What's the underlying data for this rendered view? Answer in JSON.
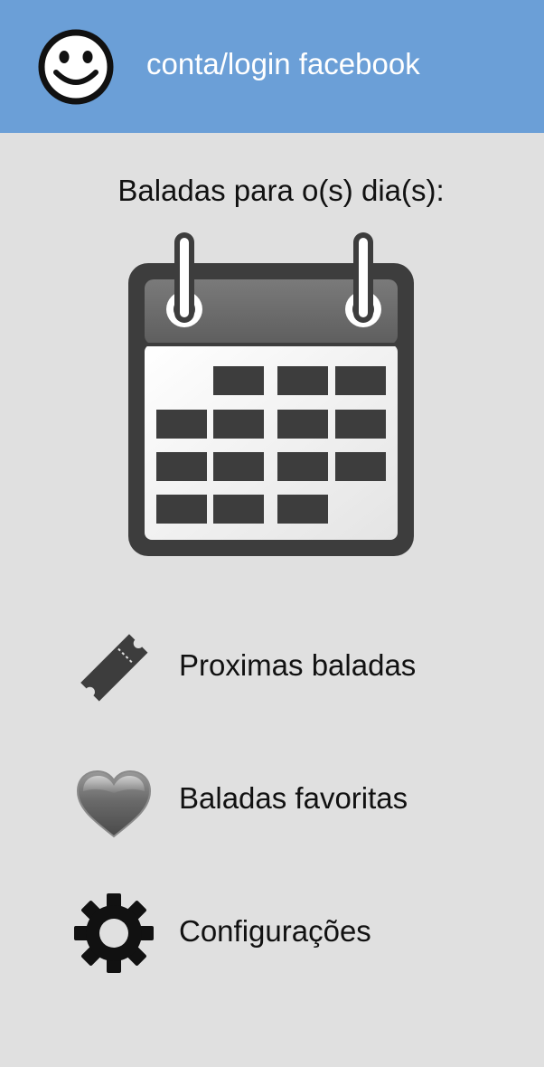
{
  "header": {
    "title": "conta/login facebook",
    "background_color": "#6b9fd7",
    "icon": "smiley-face-icon"
  },
  "date_picker": {
    "label": "Baladas para o(s) dia(s):",
    "icon": "calendar-icon"
  },
  "menu": {
    "items": [
      {
        "label": "Proximas baladas",
        "icon": "ticket-icon"
      },
      {
        "label": "Baladas favoritas",
        "icon": "heart-icon"
      },
      {
        "label": "Configurações",
        "icon": "gear-icon"
      }
    ]
  },
  "colors": {
    "page_background": "#e0e0e0",
    "text": "#111111",
    "icon_dark": "#3d3d3d"
  }
}
